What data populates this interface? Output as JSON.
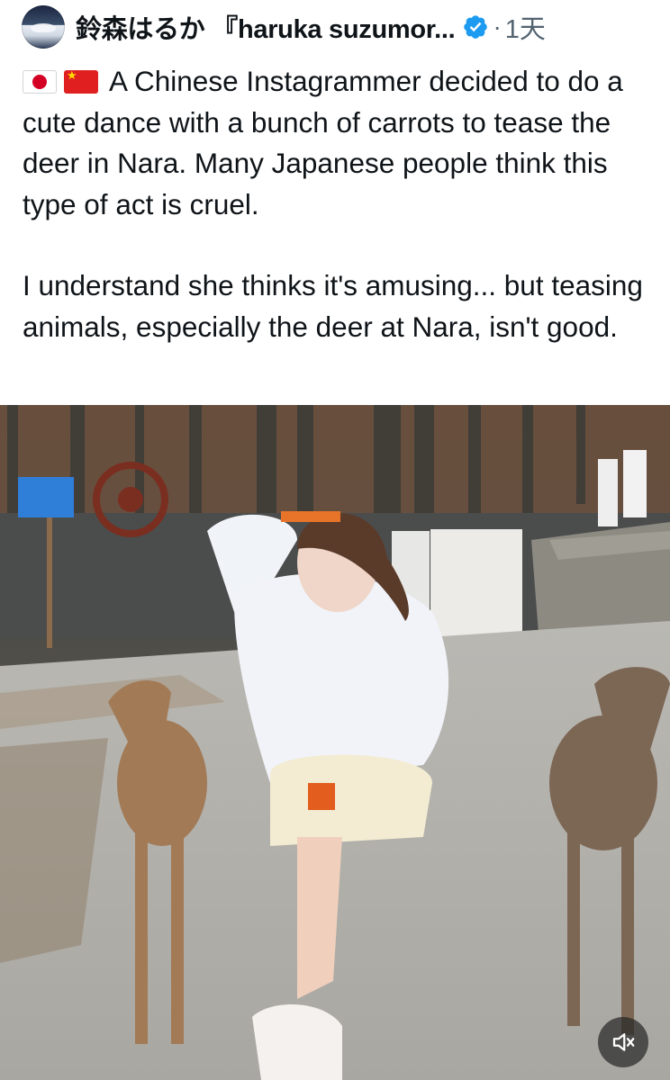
{
  "post": {
    "author": {
      "display_name": "鈴森はるか 『haruka suzumor...",
      "avatar_icon": "profile-avatar",
      "verified_icon": "verified-badge-icon",
      "verified_color": "#1d9bf0"
    },
    "separator": "·",
    "timestamp": "1天",
    "flags": [
      "japan-flag-icon",
      "china-flag-icon"
    ],
    "paragraph_1": "A Chinese Instagrammer decided to do a cute dance with a bunch of carrots to tease the deer in Nara. Many Japanese people think this type of act is cruel.",
    "paragraph_2": "I understand she thinks it's amusing... but teasing animals, especially the deer at Nara, isn't good."
  },
  "media": {
    "type": "video",
    "mute_icon": "speaker-muted-icon"
  }
}
